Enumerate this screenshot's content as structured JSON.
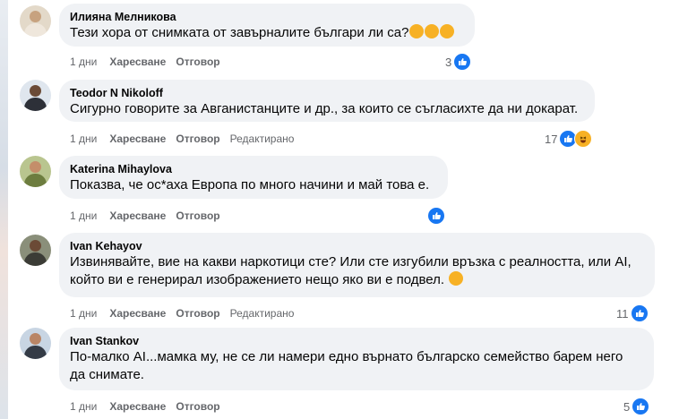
{
  "comments": [
    {
      "author": "Илияна Мелникова",
      "text": "Тези хора от снимката от завърналите българи ли са?",
      "emojis": [
        "laughing-crying",
        "laughing-crying",
        "laughing-crying"
      ],
      "time": "1 дни",
      "like_label": "Харесване",
      "reply_label": "Отговор",
      "edited": "",
      "reaction_count": "3",
      "reactions": [
        "like"
      ]
    },
    {
      "author": "Teodor N Nikoloff",
      "text": "Сигурно говорите за Авганистанците и др., за които се съгласихте да ни докарат.",
      "time": "1 дни",
      "like_label": "Харесване",
      "reply_label": "Отговор",
      "edited": "Редактирано",
      "reaction_count": "17",
      "reactions": [
        "like",
        "haha"
      ]
    },
    {
      "author": "Katerina Mihaylova",
      "text": "Показва, че ос*аха Европа по много начини и май това е.",
      "time": "1 дни",
      "like_label": "Харесване",
      "reply_label": "Отговор",
      "edited": "",
      "reaction_count": "",
      "reactions": [
        "like"
      ]
    },
    {
      "author": "Ivan Kehayov",
      "text_line1": "Извинявайте, вие на какви наркотици сте? Или сте изгубили връзка с реалността, или AI,",
      "text_line2": "който ви е генерирал изображението нещо яко ви е подвел.",
      "emojis": [
        "thinking-face"
      ],
      "time": "1 дни",
      "like_label": "Харесване",
      "reply_label": "Отговор",
      "edited": "Редактирано",
      "reaction_count": "11",
      "reactions": [
        "like"
      ]
    },
    {
      "author": "Ivan Stankov",
      "text_line1": "По-малко AI...мамка му, не се ли намери едно върнато българско семейство барем него",
      "text_line2": "да снимате.",
      "time": "1 дни",
      "like_label": "Харесване",
      "reply_label": "Отговор",
      "edited": "",
      "reaction_count": "5",
      "reactions": [
        "like"
      ]
    }
  ],
  "colors": {
    "bubble": "#f0f2f5",
    "meta": "#65676b",
    "like": "#1877f2",
    "haha": "#f7b125"
  }
}
